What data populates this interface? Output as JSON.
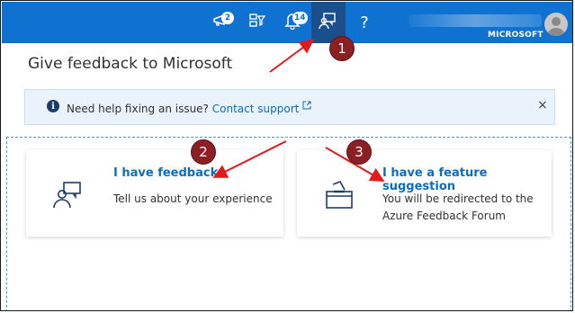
{
  "topbar": {
    "announcements_badge": "2",
    "notifications_badge": "14",
    "help_label": "?",
    "tenant": "MICROSOFT"
  },
  "page": {
    "title": "Give feedback to Microsoft"
  },
  "banner": {
    "text": "Need help fixing an issue?",
    "link": "Contact support",
    "close": "×"
  },
  "cards": [
    {
      "title": "I have feedback",
      "description": "Tell us about your experience",
      "icon": "person-feedback-icon"
    },
    {
      "title": "I have a feature suggestion",
      "description_line1": "You will be redirected to the",
      "description_line2": "Azure Feedback Forum",
      "icon": "ballot-box-icon"
    }
  ],
  "annotations": {
    "marker_1": "1",
    "marker_2": "2",
    "marker_3": "3",
    "color": "#e11b1b"
  },
  "colors": {
    "topbar": "#0f72d1",
    "active_icon_bg": "#1a4f8c",
    "link": "#0f6cbd",
    "banner_bg": "#eaf3fc",
    "marker": "#8b1f24"
  }
}
